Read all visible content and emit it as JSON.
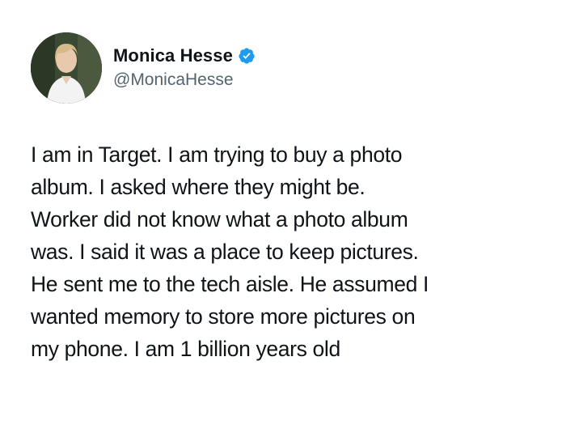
{
  "author": {
    "display_name": "Monica Hesse",
    "handle": "@MonicaHesse",
    "verified": true,
    "avatar_icon": "profile-photo",
    "verified_icon": "verified-badge-icon",
    "verified_color": "#1d9bf0"
  },
  "tweet": {
    "text": "I am in Target. I am trying to buy a photo\nalbum. I asked where they might be.\nWorker did not know what a photo album\nwas. I said it was a place to keep pictures.\nHe sent me to the tech aisle. He assumed I\nwanted memory to store more pictures on\nmy phone. I am 1 billion years old"
  }
}
